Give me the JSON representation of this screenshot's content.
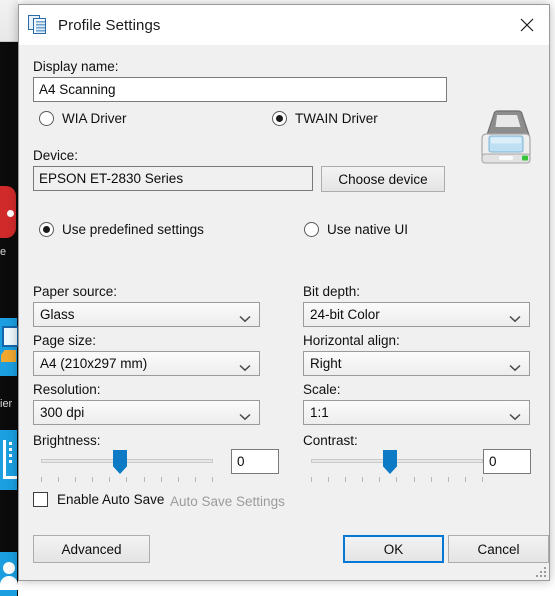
{
  "window": {
    "title": "Profile Settings",
    "icon": "profile-documents-icon",
    "close_icon": "close-icon"
  },
  "form": {
    "display_name": {
      "label": "Display name:",
      "value": "A4 Scanning",
      "placeholder": ""
    },
    "driver": {
      "options": [
        {
          "label": "WIA Driver",
          "checked": false
        },
        {
          "label": "TWAIN Driver",
          "checked": true
        }
      ]
    },
    "device": {
      "label": "Device:",
      "value": "EPSON ET-2830 Series",
      "choose_button": "Choose device"
    },
    "ui_mode": {
      "options": [
        {
          "label": "Use predefined settings",
          "checked": true
        },
        {
          "label": "Use native UI",
          "checked": false
        }
      ]
    },
    "left_column": [
      {
        "label": "Paper source:",
        "value": "Glass"
      },
      {
        "label": "Page size:",
        "value": "A4 (210x297 mm)"
      },
      {
        "label": "Resolution:",
        "value": "300 dpi"
      }
    ],
    "right_column": [
      {
        "label": "Bit depth:",
        "value": "24-bit Color"
      },
      {
        "label": "Horizontal align:",
        "value": "Right"
      },
      {
        "label": "Scale:",
        "value": "1:1"
      }
    ],
    "brightness": {
      "label": "Brightness:",
      "value": "0",
      "slider_percent": 50,
      "tick_count": 11
    },
    "contrast": {
      "label": "Contrast:",
      "value": "0",
      "slider_percent": 50,
      "tick_count": 11
    },
    "auto_save": {
      "checkbox_label": "Enable Auto Save",
      "checked": false,
      "settings_link": "Auto Save Settings",
      "settings_enabled": false
    }
  },
  "footer": {
    "advanced": "Advanced",
    "ok": "OK",
    "cancel": "Cancel"
  },
  "scanner_icon": {
    "name": "flatbed-scanner-icon",
    "glass_color": "#bfe0f2",
    "lid_color": "#8d8d8d",
    "led_color": "#35c43a"
  },
  "colors": {
    "accent": "#0078d7",
    "slider_thumb": "#0c7ac4",
    "dialog_bg": "#f0f0f0",
    "titlebar_bg": "#ffffff",
    "disabled_text": "#9b9b9b"
  }
}
